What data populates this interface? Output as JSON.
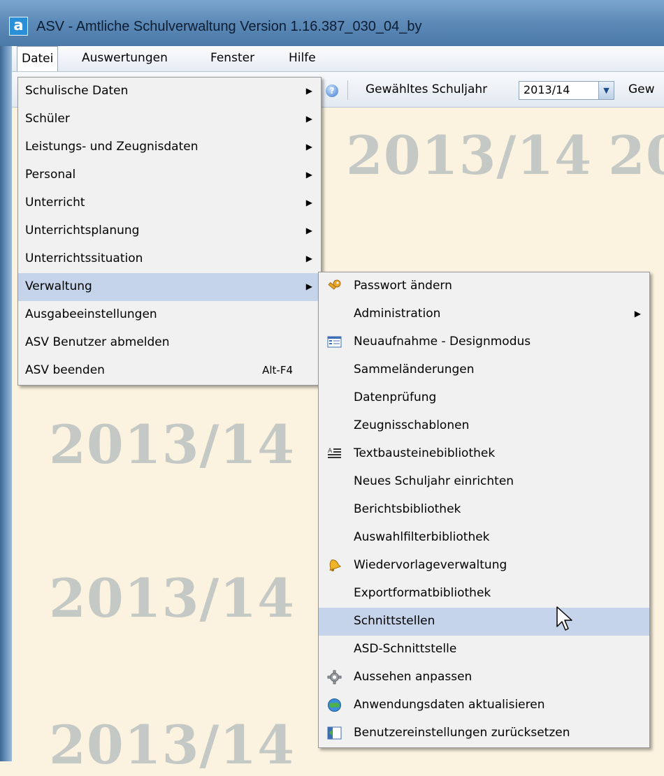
{
  "window": {
    "title": "ASV - Amtliche Schulverwaltung Version 1.16.387_030_04_by",
    "app_icon_letter": "a"
  },
  "menubar": {
    "items": [
      "Datei",
      "Auswertungen",
      "Fenster",
      "Hilfe"
    ]
  },
  "toolbar": {
    "schuljahr_label": "Gewähltes Schuljahr",
    "schuljahr_value": "2013/14",
    "next_label": "Gew"
  },
  "watermark": {
    "text": "2013/14"
  },
  "datei_menu": {
    "items": [
      {
        "label": "Schulische Daten",
        "submenu": true
      },
      {
        "label": "Schüler",
        "submenu": true
      },
      {
        "label": "Leistungs- und Zeugnisdaten",
        "submenu": true
      },
      {
        "label": "Personal",
        "submenu": true
      },
      {
        "label": "Unterricht",
        "submenu": true
      },
      {
        "label": "Unterrichtsplanung",
        "submenu": true
      },
      {
        "label": "Unterrichtssituation",
        "submenu": true
      },
      {
        "label": "Verwaltung",
        "submenu": true,
        "highlighted": true
      },
      {
        "label": "Ausgabeeinstellungen"
      },
      {
        "label": "ASV Benutzer abmelden"
      },
      {
        "label": "ASV beenden",
        "shortcut": "Alt-F4"
      }
    ]
  },
  "verwaltung_menu": {
    "items": [
      {
        "label": "Passwort ändern",
        "icon": "key-icon"
      },
      {
        "label": "Administration",
        "submenu": true
      },
      {
        "label": "Neuaufnahme - Designmodus",
        "icon": "form-icon"
      },
      {
        "label": "Sammeländerungen"
      },
      {
        "label": "Datenprüfung"
      },
      {
        "label": "Zeugnisschablonen"
      },
      {
        "label": "Textbausteinebibliothek",
        "icon": "text-block-icon"
      },
      {
        "label": "Neues Schuljahr einrichten"
      },
      {
        "label": "Berichtsbibliothek"
      },
      {
        "label": "Auswahlfilterbibliothek"
      },
      {
        "label": "Wiedervorlageverwaltung",
        "icon": "bell-icon"
      },
      {
        "label": "Exportformatbibliothek"
      },
      {
        "label": "Schnittstellen",
        "highlighted": true
      },
      {
        "label": "ASD-Schnittstelle"
      },
      {
        "label": "Aussehen anpassen",
        "icon": "gear-icon"
      },
      {
        "label": "Anwendungsdaten aktualisieren",
        "icon": "globe-refresh-icon"
      },
      {
        "label": "Benutzereinstellungen zurücksetzen",
        "icon": "reset-settings-icon"
      }
    ]
  },
  "colors": {
    "menu_highlight": "#c5d4ea",
    "background": "#fbf3df",
    "watermark": "#c5c9c6"
  }
}
